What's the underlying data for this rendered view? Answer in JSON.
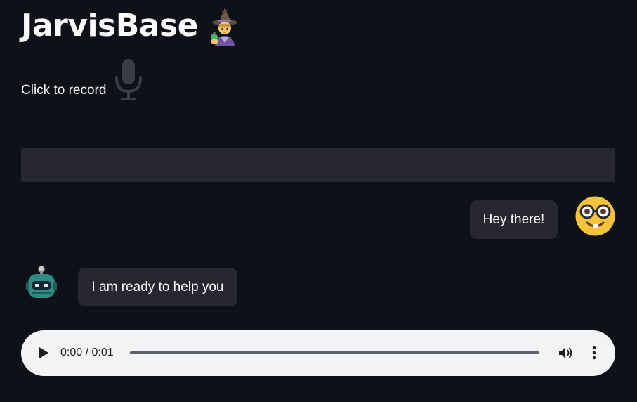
{
  "app": {
    "title": "JarvisBase",
    "title_icon": "mage-emoji-icon"
  },
  "recorder": {
    "label": "Click to record",
    "icon": "microphone-icon",
    "icon_color": "#3b3d45"
  },
  "text_box": {
    "value": ""
  },
  "chat": {
    "messages": [
      {
        "role": "user",
        "text": "Hey there!",
        "avatar": "nerd-face-emoji-icon"
      },
      {
        "role": "assistant",
        "text": "I am ready to help you",
        "avatar": "robot-avatar-icon"
      }
    ]
  },
  "audio_player": {
    "time": "0:00 / 0:01",
    "progress": 0,
    "play_icon": "play-icon",
    "volume_icon": "volume-icon",
    "menu_icon": "more-vert-icon"
  },
  "colors": {
    "background": "#0e1117",
    "bubble": "#262730",
    "text": "#fafafa",
    "player_bg": "#f1f3f4"
  }
}
